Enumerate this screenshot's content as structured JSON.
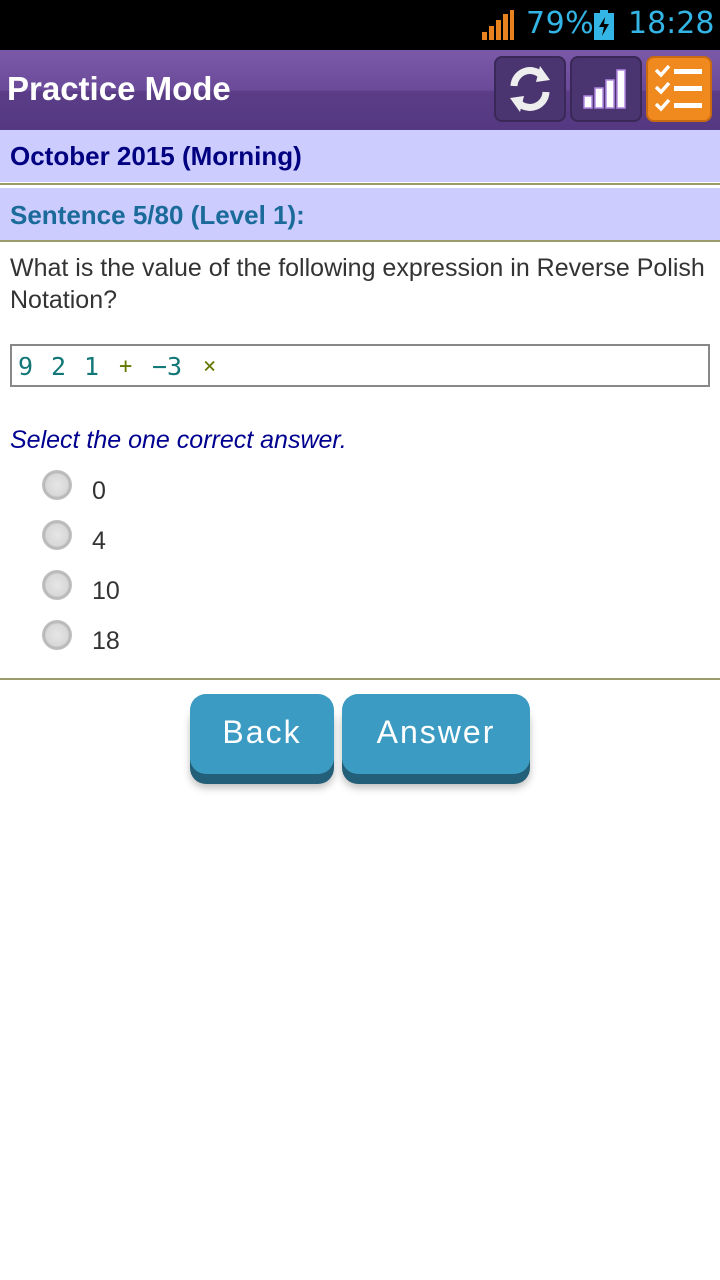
{
  "status_bar": {
    "battery_percent": "79%",
    "time": "18:28",
    "signal_icon": "signal-icon",
    "battery_icon": "battery-charging-icon",
    "accent": "#33b5e5"
  },
  "action_bar": {
    "title": "Practice Mode",
    "buttons": [
      {
        "icon": "refresh-icon"
      },
      {
        "icon": "stats-icon"
      },
      {
        "icon": "checklist-icon"
      }
    ]
  },
  "exam_header": "October 2015 (Morning)",
  "sentence_header": "Sentence 5/80 (Level 1):",
  "question": "What is the value of the following expression in Reverse Polish Notation?",
  "expression": {
    "tokens": [
      "9",
      "2",
      "1",
      "+",
      "−3",
      "×"
    ]
  },
  "instruction": "Select the one correct answer.",
  "options": [
    "0",
    "4",
    "10",
    "18"
  ],
  "buttons": {
    "back": "Back",
    "answer": "Answer"
  },
  "colors": {
    "action_bar": "#6b4a9a",
    "band": "#ccccff",
    "button": "#3c9bc2",
    "list_button": "#f08a1e"
  }
}
